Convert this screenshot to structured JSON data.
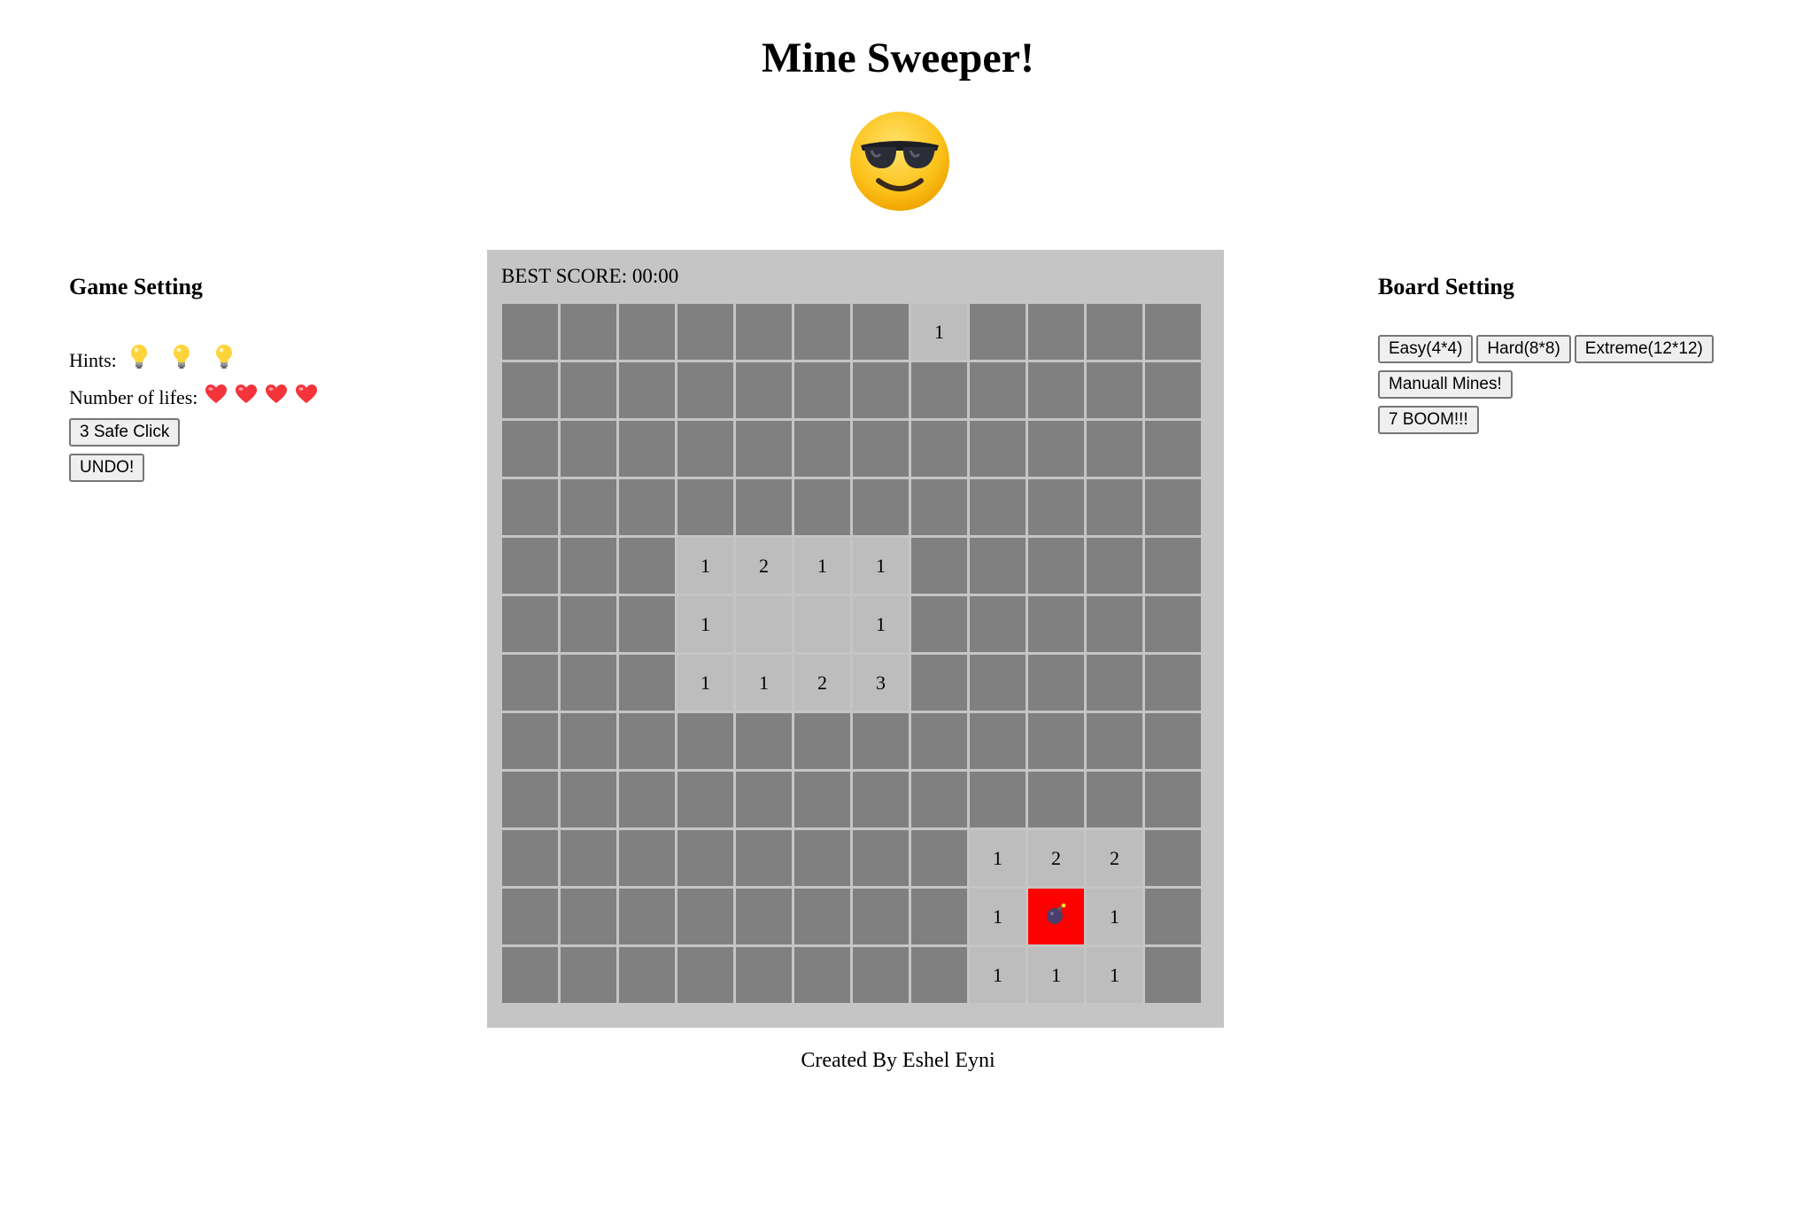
{
  "title": "Mine Sweeper!",
  "smiley_icon": "sunglasses-smiley-icon",
  "game_setting": {
    "heading": "Game Setting",
    "hints_label": "Hints:",
    "hint_icons": [
      "lightbulb-icon",
      "lightbulb-icon",
      "lightbulb-icon"
    ],
    "lives_label": "Number of lifes:",
    "life_icons": [
      "heart-icon",
      "heart-icon",
      "heart-icon",
      "heart-icon"
    ],
    "safe_click_label": "3 Safe Click",
    "undo_label": "UNDO!"
  },
  "board_setting": {
    "heading": "Board Setting",
    "easy_label": "Easy(4*4)",
    "hard_label": "Hard(8*8)",
    "extreme_label": "Extreme(12*12)",
    "manual_label": "Manuall Mines!",
    "boom_label": "7 BOOM!!!"
  },
  "best_score": "BEST SCORE: 00:00",
  "board": {
    "rows": 12,
    "cols": 12,
    "cells": [
      [
        "h",
        "h",
        "h",
        "h",
        "h",
        "h",
        "h",
        "1",
        "h",
        "h",
        "h",
        "h"
      ],
      [
        "h",
        "h",
        "h",
        "h",
        "h",
        "h",
        "h",
        "h",
        "h",
        "h",
        "h",
        "h"
      ],
      [
        "h",
        "h",
        "h",
        "h",
        "h",
        "h",
        "h",
        "h",
        "h",
        "h",
        "h",
        "h"
      ],
      [
        "h",
        "h",
        "h",
        "h",
        "h",
        "h",
        "h",
        "h",
        "h",
        "h",
        "h",
        "h"
      ],
      [
        "h",
        "h",
        "h",
        "1",
        "2",
        "1",
        "1",
        "h",
        "h",
        "h",
        "h",
        "h"
      ],
      [
        "h",
        "h",
        "h",
        "1",
        "",
        "",
        "1",
        "h",
        "h",
        "h",
        "h",
        "h"
      ],
      [
        "h",
        "h",
        "h",
        "1",
        "1",
        "2",
        "3",
        "h",
        "h",
        "h",
        "h",
        "h"
      ],
      [
        "h",
        "h",
        "h",
        "h",
        "h",
        "h",
        "h",
        "h",
        "h",
        "h",
        "h",
        "h"
      ],
      [
        "h",
        "h",
        "h",
        "h",
        "h",
        "h",
        "h",
        "h",
        "h",
        "h",
        "h",
        "h"
      ],
      [
        "h",
        "h",
        "h",
        "h",
        "h",
        "h",
        "h",
        "h",
        "1",
        "2",
        "2",
        "h"
      ],
      [
        "h",
        "h",
        "h",
        "h",
        "h",
        "h",
        "h",
        "h",
        "1",
        "*",
        "1",
        "h"
      ],
      [
        "h",
        "h",
        "h",
        "h",
        "h",
        "h",
        "h",
        "h",
        "1",
        "1",
        "1",
        "h"
      ]
    ],
    "legend": {
      "h": "hidden",
      "*": "exploded-mine",
      "": "open-empty"
    },
    "hidden_color": "#808080",
    "open_color": "#bdbdbd",
    "mine_color": "#ff0000",
    "mine_icon": "bomb-icon"
  },
  "footer": "Created By Eshel Eyni"
}
